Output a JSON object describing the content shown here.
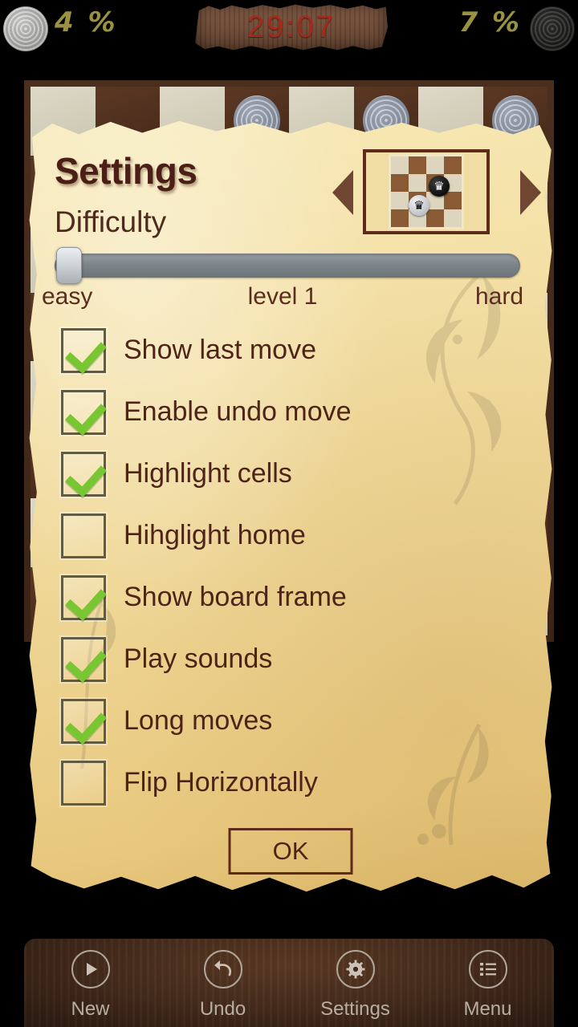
{
  "statusbar": {
    "left_piece_icon": "light-checker-piece-icon",
    "left_percent": "4 %",
    "timer": "29:07",
    "right_percent": "7 %",
    "right_piece_icon": "dark-checker-piece-icon"
  },
  "dialog": {
    "title": "Settings",
    "theme": {
      "prev_arrow_icon": "arrow-left-icon",
      "next_arrow_icon": "arrow-right-icon",
      "preview_pieces": [
        {
          "type": "dark-king",
          "glyph": "♛"
        },
        {
          "type": "light-king",
          "glyph": "♛"
        }
      ]
    },
    "difficulty": {
      "label": "Difficulty",
      "value": 0,
      "min": 0,
      "max": 100,
      "min_label": "easy",
      "value_label": "level 1",
      "max_label": "hard"
    },
    "options": [
      {
        "label": "Show last move",
        "checked": true
      },
      {
        "label": "Enable undo move",
        "checked": true
      },
      {
        "label": "Highlight cells",
        "checked": true
      },
      {
        "label": "Hihglight home",
        "checked": false
      },
      {
        "label": "Show board frame",
        "checked": true
      },
      {
        "label": "Play sounds",
        "checked": true
      },
      {
        "label": "Long moves",
        "checked": true
      },
      {
        "label": "Flip Horizontally",
        "checked": false
      }
    ],
    "ok_label": "OK"
  },
  "toolbar": [
    {
      "label": "New",
      "icon": "play-icon"
    },
    {
      "label": "Undo",
      "icon": "undo-arrow-icon"
    },
    {
      "label": "Settings",
      "icon": "gear-icon"
    },
    {
      "label": "Menu",
      "icon": "list-icon"
    }
  ],
  "colors": {
    "parchment_light": "#f7e9b6",
    "parchment_dark": "#dcb869",
    "text_brown": "#4e2318",
    "title_brown": "#4b1f17",
    "check_green": "#78c631",
    "timer_red": "#a32b1c",
    "percent_olive": "#9a9240",
    "arrow_brown": "#6e4632",
    "border_brown": "#5e2a1c"
  }
}
